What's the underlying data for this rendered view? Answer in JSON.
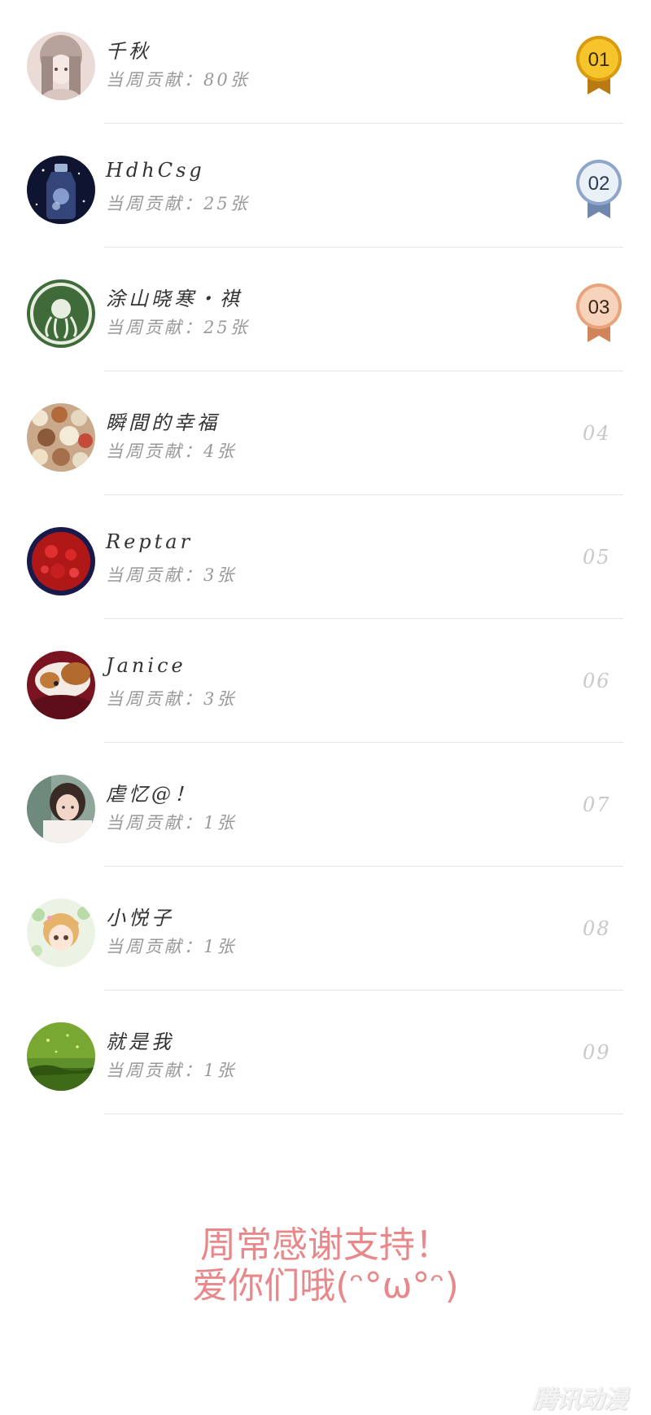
{
  "ranking": [
    {
      "name": "千秋",
      "contribution": "当周贡献：80张",
      "rank": "01",
      "medal": "gold"
    },
    {
      "name": "HdhCsg",
      "contribution": "当周贡献：25张",
      "rank": "02",
      "medal": "silver"
    },
    {
      "name": "涂山晓寒・祺",
      "contribution": "当周贡献：25张",
      "rank": "03",
      "medal": "bronze"
    },
    {
      "name": "瞬間的幸福",
      "contribution": "当周贡献：4张",
      "rank": "04",
      "medal": ""
    },
    {
      "name": "Reptar",
      "contribution": "当周贡献：3张",
      "rank": "05",
      "medal": ""
    },
    {
      "name": "Janice",
      "contribution": "当周贡献：3张",
      "rank": "06",
      "medal": ""
    },
    {
      "name": "虐忆@！",
      "contribution": "当周贡献：1张",
      "rank": "07",
      "medal": ""
    },
    {
      "name": "小悦子",
      "contribution": "当周贡献：1张",
      "rank": "08",
      "medal": ""
    },
    {
      "name": "就是我",
      "contribution": "当周贡献：1张",
      "rank": "09",
      "medal": ""
    }
  ],
  "thanks": {
    "line1": "周常感谢支持！",
    "line2": "爱你们哦(ᵔ°ω°ᵔ)"
  },
  "watermark": "腾讯动漫",
  "colors": {
    "gold": "#f2b81b",
    "silver": "#8ea6c9",
    "bronze": "#e8a47c",
    "thanks": "#e9888a"
  }
}
